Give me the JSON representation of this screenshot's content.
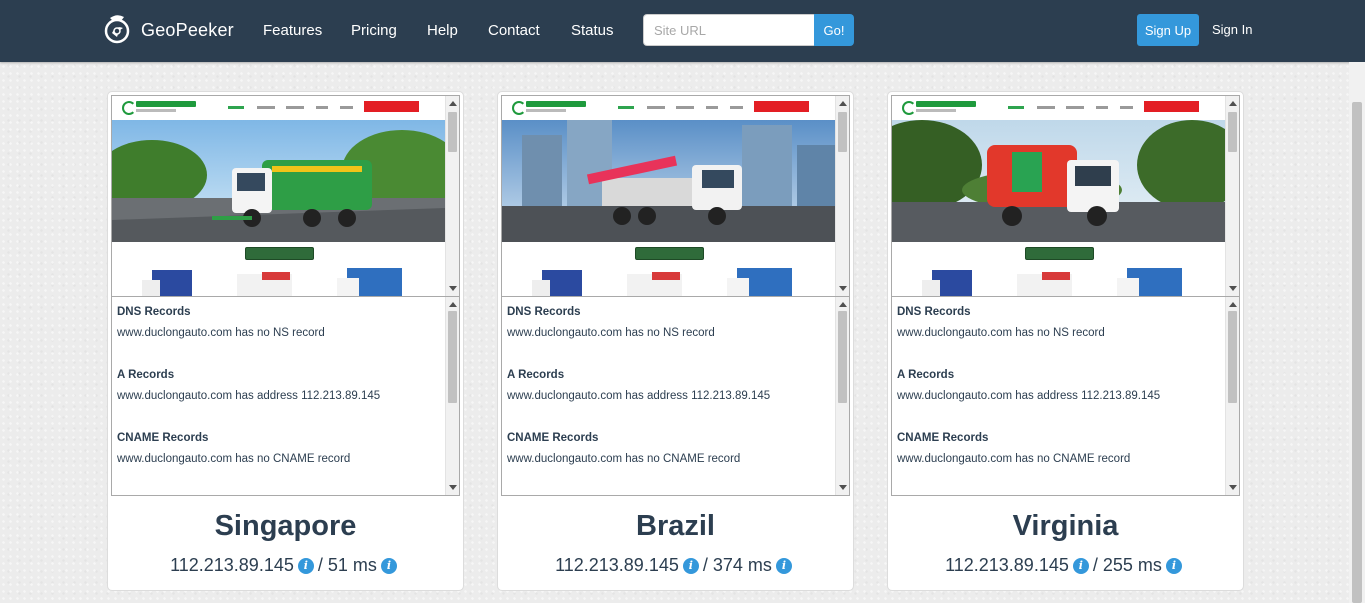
{
  "navbar": {
    "brand": "GeoPeeker",
    "links": [
      "Features",
      "Pricing",
      "Help",
      "Contact",
      "Status"
    ],
    "search_placeholder": "Site URL",
    "search_value": "",
    "go_label": "Go!",
    "signup_label": "Sign Up",
    "signin_label": "Sign In"
  },
  "dns_labels": {
    "dns_records": "DNS Records",
    "a_records": "A Records",
    "cname_records": "CNAME Records"
  },
  "locations": [
    {
      "name": "Singapore",
      "ip": "112.213.89.145",
      "latency": "51 ms",
      "ns": "www.duclongauto.com has no NS record",
      "a": "www.duclongauto.com has address 112.213.89.145",
      "cname": "www.duclongauto.com has no CNAME record",
      "hero": "green sweeper truck on road"
    },
    {
      "name": "Brazil",
      "ip": "112.213.89.145",
      "latency": "374 ms",
      "ns": "www.duclongauto.com has no NS record",
      "a": "www.duclongauto.com has address 112.213.89.145",
      "cname": "www.duclongauto.com has no CNAME record",
      "hero": "crane truck with city buildings"
    },
    {
      "name": "Virginia",
      "ip": "112.213.89.145",
      "latency": "255 ms",
      "ns": "www.duclongauto.com has no NS record",
      "a": "www.duclongauto.com has address 112.213.89.145",
      "cname": "www.duclongauto.com has no CNAME record",
      "hero": "red garbage truck on road"
    }
  ],
  "separator": "/",
  "colors": {
    "navbar": "#2c3e50",
    "accent": "#3498db",
    "text": "#2c3e50"
  }
}
